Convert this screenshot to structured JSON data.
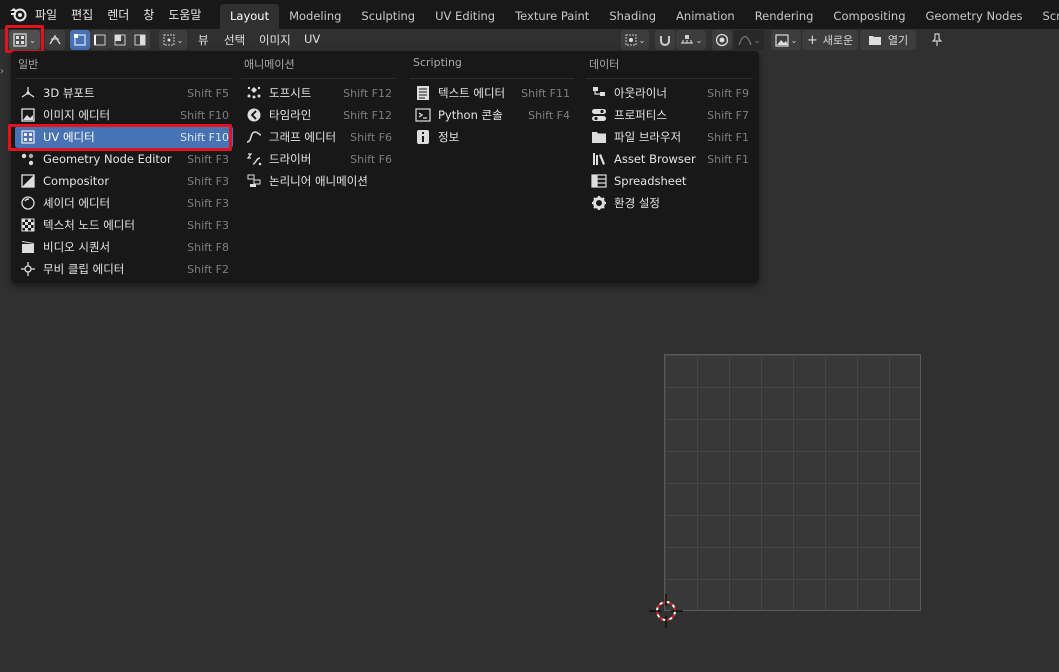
{
  "topbar": {
    "menus": [
      "파일",
      "편집",
      "렌더",
      "창",
      "도움말"
    ],
    "workspaces": [
      "Layout",
      "Modeling",
      "Sculpting",
      "UV Editing",
      "Texture Paint",
      "Shading",
      "Animation",
      "Rendering",
      "Compositing",
      "Geometry Nodes",
      "Scripting"
    ],
    "active_workspace": "Layout"
  },
  "header": {
    "menus": [
      "뷰",
      "선택",
      "이미지",
      "UV"
    ],
    "new_label": "새로운",
    "open_label": "열기"
  },
  "editor_menu": {
    "columns": [
      {
        "heading": "일반",
        "items": [
          {
            "label": "3D 뷰포트",
            "shortcut": "Shift F5",
            "icon": "3d-viewport-icon"
          },
          {
            "label": "이미지 에디터",
            "shortcut": "Shift F10",
            "icon": "image-editor-icon"
          },
          {
            "label": "UV 에디터",
            "shortcut": "Shift F10",
            "icon": "uv-editor-icon",
            "selected": true
          },
          {
            "label": "Geometry Node Editor",
            "shortcut": "Shift F3",
            "icon": "geometry-nodes-icon"
          },
          {
            "label": "Compositor",
            "shortcut": "Shift F3",
            "icon": "compositor-icon"
          },
          {
            "label": "셰이더 에디터",
            "shortcut": "Shift F3",
            "icon": "shader-editor-icon"
          },
          {
            "label": "텍스처 노드 에디터",
            "shortcut": "Shift F3",
            "icon": "texture-nodes-icon"
          },
          {
            "label": "비디오 시퀀서",
            "shortcut": "Shift F8",
            "icon": "video-sequencer-icon"
          },
          {
            "label": "무비 클립 에디터",
            "shortcut": "Shift F2",
            "icon": "movie-clip-icon"
          }
        ]
      },
      {
        "heading": "애니메이션",
        "items": [
          {
            "label": "도프시트",
            "shortcut": "Shift F12",
            "icon": "dopesheet-icon"
          },
          {
            "label": "타임라인",
            "shortcut": "Shift F12",
            "icon": "timeline-icon"
          },
          {
            "label": "그래프 에디터",
            "shortcut": "Shift F6",
            "icon": "graph-editor-icon"
          },
          {
            "label": "드라이버",
            "shortcut": "Shift F6",
            "icon": "drivers-icon"
          },
          {
            "label": "논리니어 애니메이션",
            "shortcut": "",
            "icon": "nla-icon"
          }
        ]
      },
      {
        "heading": "Scripting",
        "items": [
          {
            "label": "텍스트 에디터",
            "shortcut": "Shift F11",
            "icon": "text-editor-icon"
          },
          {
            "label": "Python 콘솔",
            "shortcut": "Shift F4",
            "icon": "python-console-icon"
          },
          {
            "label": "정보",
            "shortcut": "",
            "icon": "info-icon"
          }
        ]
      },
      {
        "heading": "데이터",
        "items": [
          {
            "label": "아웃라이너",
            "shortcut": "Shift F9",
            "icon": "outliner-icon"
          },
          {
            "label": "프로퍼티스",
            "shortcut": "Shift F7",
            "icon": "properties-icon"
          },
          {
            "label": "파일 브라우저",
            "shortcut": "Shift F1",
            "icon": "file-browser-icon"
          },
          {
            "label": "Asset Browser",
            "shortcut": "Shift F1",
            "icon": "asset-browser-icon"
          },
          {
            "label": "Spreadsheet",
            "shortcut": "",
            "icon": "spreadsheet-icon"
          },
          {
            "label": "환경 설정",
            "shortcut": "",
            "icon": "preferences-icon"
          }
        ]
      }
    ]
  },
  "colors": {
    "selected": "#4772b3",
    "highlight": "#e3121f",
    "background": "#303030",
    "menu_bg": "#181818"
  }
}
